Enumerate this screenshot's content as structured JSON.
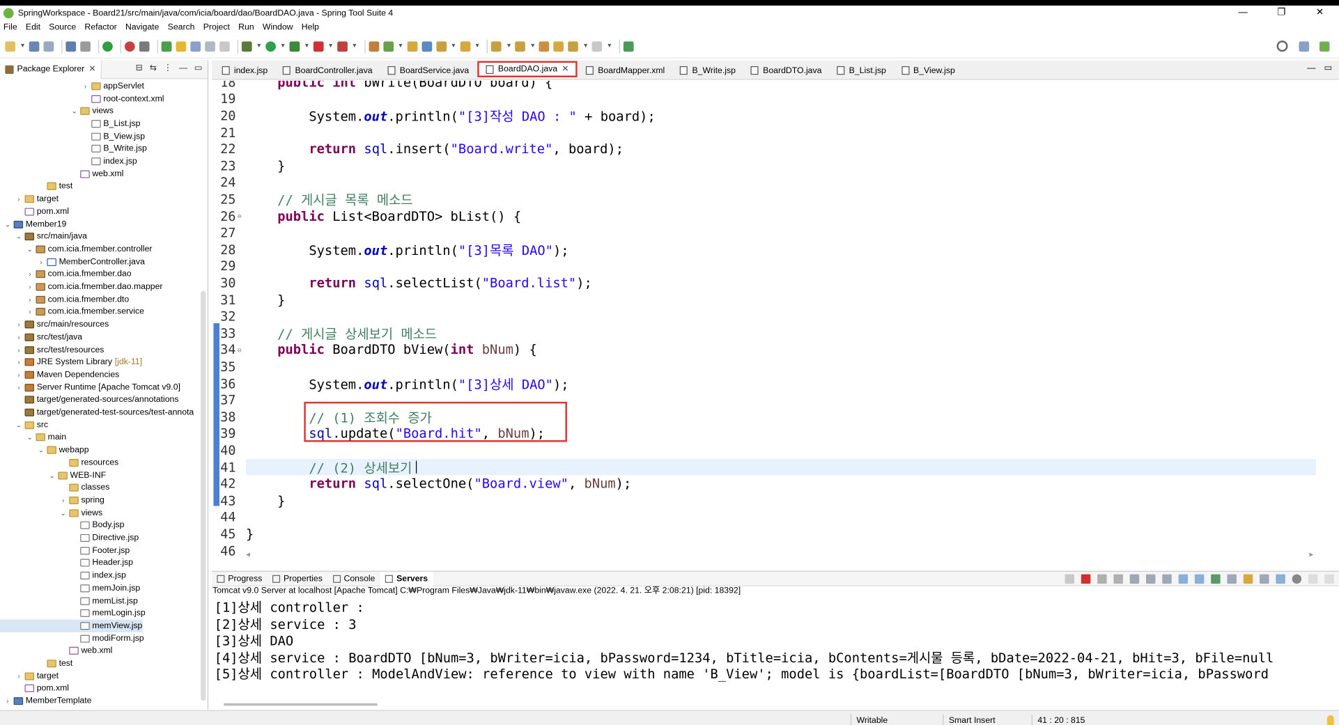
{
  "window": {
    "title": "SpringWorkspace - Board21/src/main/java/com/icia/board/dao/BoardDAO.java - Spring Tool Suite 4",
    "controls": [
      "—",
      "❐",
      "✕"
    ]
  },
  "menu": [
    "File",
    "Edit",
    "Source",
    "Refactor",
    "Navigate",
    "Search",
    "Project",
    "Run",
    "Window",
    "Help"
  ],
  "package_explorer": {
    "tab_label": "Package Explorer",
    "tree": [
      {
        "indent": 7,
        "arrow": "›",
        "icon": "folder",
        "label": "appServlet"
      },
      {
        "indent": 7,
        "arrow": "",
        "icon": "xml",
        "label": "root-context.xml"
      },
      {
        "indent": 6,
        "arrow": "⌄",
        "icon": "folder",
        "label": "views"
      },
      {
        "indent": 7,
        "arrow": "",
        "icon": "file",
        "label": "B_List.jsp"
      },
      {
        "indent": 7,
        "arrow": "",
        "icon": "file",
        "label": "B_View.jsp"
      },
      {
        "indent": 7,
        "arrow": "",
        "icon": "file",
        "label": "B_Write.jsp"
      },
      {
        "indent": 7,
        "arrow": "",
        "icon": "file",
        "label": "index.jsp"
      },
      {
        "indent": 6,
        "arrow": "",
        "icon": "xml",
        "label": "web.xml"
      },
      {
        "indent": 3,
        "arrow": "",
        "icon": "folder",
        "label": "test"
      },
      {
        "indent": 1,
        "arrow": "›",
        "icon": "folder",
        "label": "target"
      },
      {
        "indent": 1,
        "arrow": "",
        "icon": "xml",
        "label": "pom.xml"
      },
      {
        "indent": 0,
        "arrow": "⌄",
        "icon": "project",
        "label": "Member19"
      },
      {
        "indent": 1,
        "arrow": "⌄",
        "icon": "srcfolder",
        "label": "src/main/java"
      },
      {
        "indent": 2,
        "arrow": "⌄",
        "icon": "pkg",
        "label": "com.icia.fmember.controller"
      },
      {
        "indent": 3,
        "arrow": "›",
        "icon": "java",
        "label": "MemberController.java"
      },
      {
        "indent": 2,
        "arrow": "›",
        "icon": "pkg",
        "label": "com.icia.fmember.dao"
      },
      {
        "indent": 2,
        "arrow": "›",
        "icon": "pkg",
        "label": "com.icia.fmember.dao.mapper"
      },
      {
        "indent": 2,
        "arrow": "›",
        "icon": "pkg",
        "label": "com.icia.fmember.dto"
      },
      {
        "indent": 2,
        "arrow": "›",
        "icon": "pkg",
        "label": "com.icia.fmember.service"
      },
      {
        "indent": 1,
        "arrow": "›",
        "icon": "srcfolder",
        "label": "src/main/resources"
      },
      {
        "indent": 1,
        "arrow": "›",
        "icon": "srcfolder",
        "label": "src/test/java"
      },
      {
        "indent": 1,
        "arrow": "›",
        "icon": "srcfolder",
        "label": "src/test/resources"
      },
      {
        "indent": 1,
        "arrow": "›",
        "icon": "lib",
        "label": "JRE System Library",
        "decor": "[jdk-11]"
      },
      {
        "indent": 1,
        "arrow": "›",
        "icon": "lib",
        "label": "Maven Dependencies"
      },
      {
        "indent": 1,
        "arrow": "›",
        "icon": "lib",
        "label": "Server Runtime [Apache Tomcat v9.0]"
      },
      {
        "indent": 1,
        "arrow": "",
        "icon": "srcfolder",
        "label": "target/generated-sources/annotations"
      },
      {
        "indent": 1,
        "arrow": "",
        "icon": "srcfolder",
        "label": "target/generated-test-sources/test-annota"
      },
      {
        "indent": 1,
        "arrow": "⌄",
        "icon": "folder",
        "label": "src"
      },
      {
        "indent": 2,
        "arrow": "⌄",
        "icon": "folder",
        "label": "main"
      },
      {
        "indent": 3,
        "arrow": "⌄",
        "icon": "folder",
        "label": "webapp"
      },
      {
        "indent": 5,
        "arrow": "",
        "icon": "folder",
        "label": "resources"
      },
      {
        "indent": 4,
        "arrow": "⌄",
        "icon": "folder",
        "label": "WEB-INF"
      },
      {
        "indent": 5,
        "arrow": "",
        "icon": "folder",
        "label": "classes"
      },
      {
        "indent": 5,
        "arrow": "›",
        "icon": "folder",
        "label": "spring"
      },
      {
        "indent": 5,
        "arrow": "⌄",
        "icon": "folder",
        "label": "views"
      },
      {
        "indent": 6,
        "arrow": "",
        "icon": "file",
        "label": "Body.jsp"
      },
      {
        "indent": 6,
        "arrow": "",
        "icon": "file",
        "label": "Directive.jsp"
      },
      {
        "indent": 6,
        "arrow": "",
        "icon": "file",
        "label": "Footer.jsp"
      },
      {
        "indent": 6,
        "arrow": "",
        "icon": "file",
        "label": "Header.jsp"
      },
      {
        "indent": 6,
        "arrow": "",
        "icon": "file",
        "label": "index.jsp"
      },
      {
        "indent": 6,
        "arrow": "",
        "icon": "file",
        "label": "memJoin.jsp"
      },
      {
        "indent": 6,
        "arrow": "",
        "icon": "file",
        "label": "memList.jsp"
      },
      {
        "indent": 6,
        "arrow": "",
        "icon": "file",
        "label": "memLogin.jsp"
      },
      {
        "indent": 6,
        "arrow": "",
        "icon": "file",
        "label": "memView.jsp",
        "selected": true
      },
      {
        "indent": 6,
        "arrow": "",
        "icon": "file",
        "label": "modiForm.jsp"
      },
      {
        "indent": 5,
        "arrow": "",
        "icon": "xml",
        "label": "web.xml"
      },
      {
        "indent": 3,
        "arrow": "",
        "icon": "folder",
        "label": "test"
      },
      {
        "indent": 1,
        "arrow": "›",
        "icon": "folder",
        "label": "target"
      },
      {
        "indent": 1,
        "arrow": "",
        "icon": "xml",
        "label": "pom.xml"
      },
      {
        "indent": 0,
        "arrow": "›",
        "icon": "project",
        "label": "MemberTemplate"
      }
    ]
  },
  "editor": {
    "tabs": [
      {
        "label": "index.jsp",
        "active": false
      },
      {
        "label": "BoardController.java",
        "active": false
      },
      {
        "label": "BoardService.java",
        "active": false
      },
      {
        "label": "BoardDAO.java",
        "active": true
      },
      {
        "label": "BoardMapper.xml",
        "active": false
      },
      {
        "label": "B_Write.jsp",
        "active": false
      },
      {
        "label": "BoardDTO.java",
        "active": false
      },
      {
        "label": "B_List.jsp",
        "active": false
      },
      {
        "label": "B_View.jsp",
        "active": false
      }
    ],
    "lines": [
      {
        "n": "18",
        "fold": "",
        "segs": [
          [
            "    ",
            ""
          ],
          [
            "public",
            "kw"
          ],
          [
            " ",
            ""
          ],
          [
            "int",
            "kw"
          ],
          [
            " bWrite(BoardDTO board) {",
            ""
          ]
        ]
      },
      {
        "n": "19",
        "fold": "",
        "segs": []
      },
      {
        "n": "20",
        "fold": "",
        "segs": [
          [
            "        System.",
            ""
          ],
          [
            "out",
            "fld"
          ],
          [
            ".println(",
            ""
          ],
          [
            "\"[3]작성 DAO : \"",
            "str"
          ],
          [
            " + board);",
            ""
          ]
        ]
      },
      {
        "n": "21",
        "fold": "",
        "segs": []
      },
      {
        "n": "22",
        "fold": "",
        "segs": [
          [
            "        ",
            ""
          ],
          [
            "return",
            "kw"
          ],
          [
            " ",
            ""
          ],
          [
            "sql",
            "fldn"
          ],
          [
            ".insert(",
            ""
          ],
          [
            "\"Board.write\"",
            "str"
          ],
          [
            ", board);",
            ""
          ]
        ]
      },
      {
        "n": "23",
        "fold": "",
        "segs": [
          [
            "    }",
            ""
          ]
        ]
      },
      {
        "n": "24",
        "fold": "",
        "segs": []
      },
      {
        "n": "25",
        "fold": "",
        "segs": [
          [
            "    // 게시글 목록 메소드",
            "cmt"
          ]
        ]
      },
      {
        "n": "26",
        "fold": "⊖",
        "segs": [
          [
            "    ",
            ""
          ],
          [
            "public",
            "kw"
          ],
          [
            " List<BoardDTO> bList() {",
            ""
          ]
        ]
      },
      {
        "n": "27",
        "fold": "",
        "segs": []
      },
      {
        "n": "28",
        "fold": "",
        "segs": [
          [
            "        System.",
            ""
          ],
          [
            "out",
            "fld"
          ],
          [
            ".println(",
            ""
          ],
          [
            "\"[3]목록 DAO\"",
            "str"
          ],
          [
            ");",
            ""
          ]
        ]
      },
      {
        "n": "29",
        "fold": "",
        "segs": []
      },
      {
        "n": "30",
        "fold": "",
        "segs": [
          [
            "        ",
            ""
          ],
          [
            "return",
            "kw"
          ],
          [
            " ",
            ""
          ],
          [
            "sql",
            "fldn"
          ],
          [
            ".selectList(",
            ""
          ],
          [
            "\"Board.list\"",
            "str"
          ],
          [
            ");",
            ""
          ]
        ]
      },
      {
        "n": "31",
        "fold": "",
        "segs": [
          [
            "    }",
            ""
          ]
        ]
      },
      {
        "n": "32",
        "fold": "",
        "segs": []
      },
      {
        "n": "33",
        "fold": "",
        "segs": [
          [
            "    // 게시글 상세보기 메소드",
            "cmt"
          ]
        ]
      },
      {
        "n": "34",
        "fold": "⊖",
        "segs": [
          [
            "    ",
            ""
          ],
          [
            "public",
            "kw"
          ],
          [
            " BoardDTO bView(",
            ""
          ],
          [
            "int",
            "kw"
          ],
          [
            " ",
            ""
          ],
          [
            "bNum",
            "prm"
          ],
          [
            ") {",
            ""
          ]
        ]
      },
      {
        "n": "35",
        "fold": "",
        "segs": []
      },
      {
        "n": "36",
        "fold": "",
        "segs": [
          [
            "        System.",
            ""
          ],
          [
            "out",
            "fld"
          ],
          [
            ".println(",
            ""
          ],
          [
            "\"[3]상세 DAO\"",
            "str"
          ],
          [
            ");",
            ""
          ]
        ]
      },
      {
        "n": "37",
        "fold": "",
        "segs": []
      },
      {
        "n": "38",
        "fold": "",
        "segs": [
          [
            "        // (1) 조회수 증가",
            "cmt"
          ]
        ]
      },
      {
        "n": "39",
        "fold": "",
        "segs": [
          [
            "        ",
            ""
          ],
          [
            "sql",
            "fldn"
          ],
          [
            ".update(",
            ""
          ],
          [
            "\"Board.hit\"",
            "str"
          ],
          [
            ", ",
            ""
          ],
          [
            "bNum",
            "prm"
          ],
          [
            ");",
            ""
          ]
        ]
      },
      {
        "n": "40",
        "fold": "",
        "segs": []
      },
      {
        "n": "41",
        "fold": "",
        "segs": [
          [
            "        // (2) 상세보기",
            "cmt"
          ]
        ],
        "current": true
      },
      {
        "n": "42",
        "fold": "",
        "segs": [
          [
            "        ",
            ""
          ],
          [
            "return",
            "kw"
          ],
          [
            " ",
            ""
          ],
          [
            "sql",
            "fldn"
          ],
          [
            ".selectOne(",
            ""
          ],
          [
            "\"Board.view\"",
            "str"
          ],
          [
            ", ",
            ""
          ],
          [
            "bNum",
            "prm"
          ],
          [
            ");",
            ""
          ]
        ]
      },
      {
        "n": "43",
        "fold": "",
        "segs": [
          [
            "    }",
            ""
          ]
        ]
      },
      {
        "n": "44",
        "fold": "",
        "segs": []
      },
      {
        "n": "45",
        "fold": "",
        "segs": [
          [
            "}",
            ""
          ]
        ]
      },
      {
        "n": "46",
        "fold": "",
        "segs": []
      }
    ]
  },
  "console": {
    "tabs": [
      {
        "label": "Progress",
        "active": false
      },
      {
        "label": "Properties",
        "active": false
      },
      {
        "label": "Console",
        "active": false
      },
      {
        "label": "Servers",
        "active": true
      }
    ],
    "description": "Tomcat v9.0 Server at localhost [Apache Tomcat] C:₩Program Files₩Java₩jdk-11₩bin₩javaw.exe  (2022. 4. 21. 오후 2:08:21) [pid: 18392]",
    "output": [
      "[1]상세 controller :",
      "[2]상세 service : 3",
      "[3]상세 DAO",
      "[4]상세 service : BoardDTO [bNum=3, bWriter=icia, bPassword=1234, bTitle=icia, bContents=게시물 등록, bDate=2022-04-21, bHit=3, bFile=null",
      "[5]상세 controller : ModelAndView: reference to view with name 'B_View'; model is {boardList=[BoardDTO [bNum=3, bWriter=icia, bPassword"
    ]
  },
  "status": {
    "mode": "Writable",
    "insert": "Smart Insert",
    "position": "41 : 20 : 815"
  },
  "colors": {
    "keyword": "#7f0055",
    "string": "#2a00ff",
    "comment": "#3f7f5f",
    "field": "#0000c0",
    "highlight": "#e53030"
  }
}
